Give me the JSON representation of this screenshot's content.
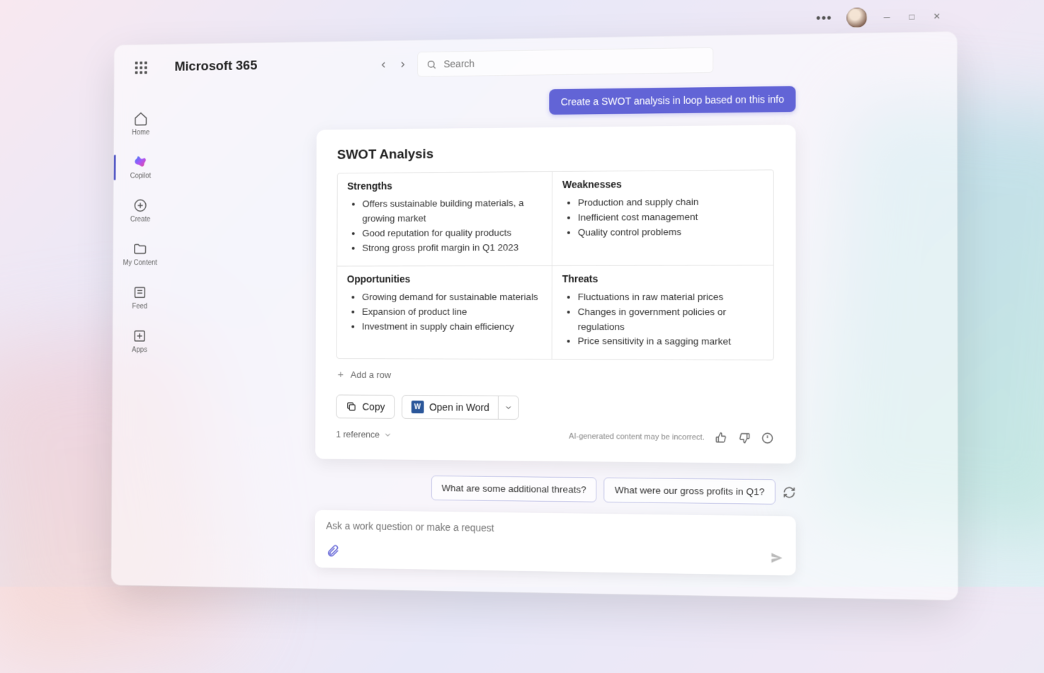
{
  "brand": "Microsoft 365",
  "search": {
    "placeholder": "Search"
  },
  "sidebar": {
    "items": [
      {
        "label": "Home"
      },
      {
        "label": "Copilot"
      },
      {
        "label": "Create"
      },
      {
        "label": "My Content"
      },
      {
        "label": "Feed"
      },
      {
        "label": "Apps"
      }
    ]
  },
  "user_prompt": "Create a SWOT analysis in loop based on this info",
  "swot": {
    "title": "SWOT Analysis",
    "quadrants": {
      "strengths": {
        "heading": "Strengths",
        "items": [
          "Offers sustainable building materials, a growing market",
          "Good reputation for quality products",
          "Strong gross profit margin in Q1 2023"
        ]
      },
      "weaknesses": {
        "heading": "Weaknesses",
        "items": [
          "Production and supply chain",
          "Inefficient cost management",
          "Quality control problems"
        ]
      },
      "opportunities": {
        "heading": "Opportunities",
        "items": [
          "Growing demand for sustainable materials",
          "Expansion of product line",
          "Investment in supply chain efficiency"
        ]
      },
      "threats": {
        "heading": "Threats",
        "items": [
          "Fluctuations in raw material prices",
          "Changes in government policies or regulations",
          "Price sensitivity in a sagging market"
        ]
      }
    },
    "add_row_label": "Add a row"
  },
  "actions": {
    "copy_label": "Copy",
    "open_word_label": "Open in Word"
  },
  "footer": {
    "reference_label": "1 reference",
    "disclaimer": "AI-generated content may be incorrect."
  },
  "suggestions": [
    "What are some additional threats?",
    "What were our gross profits in Q1?"
  ],
  "composer": {
    "placeholder": "Ask a work question or make a request"
  }
}
